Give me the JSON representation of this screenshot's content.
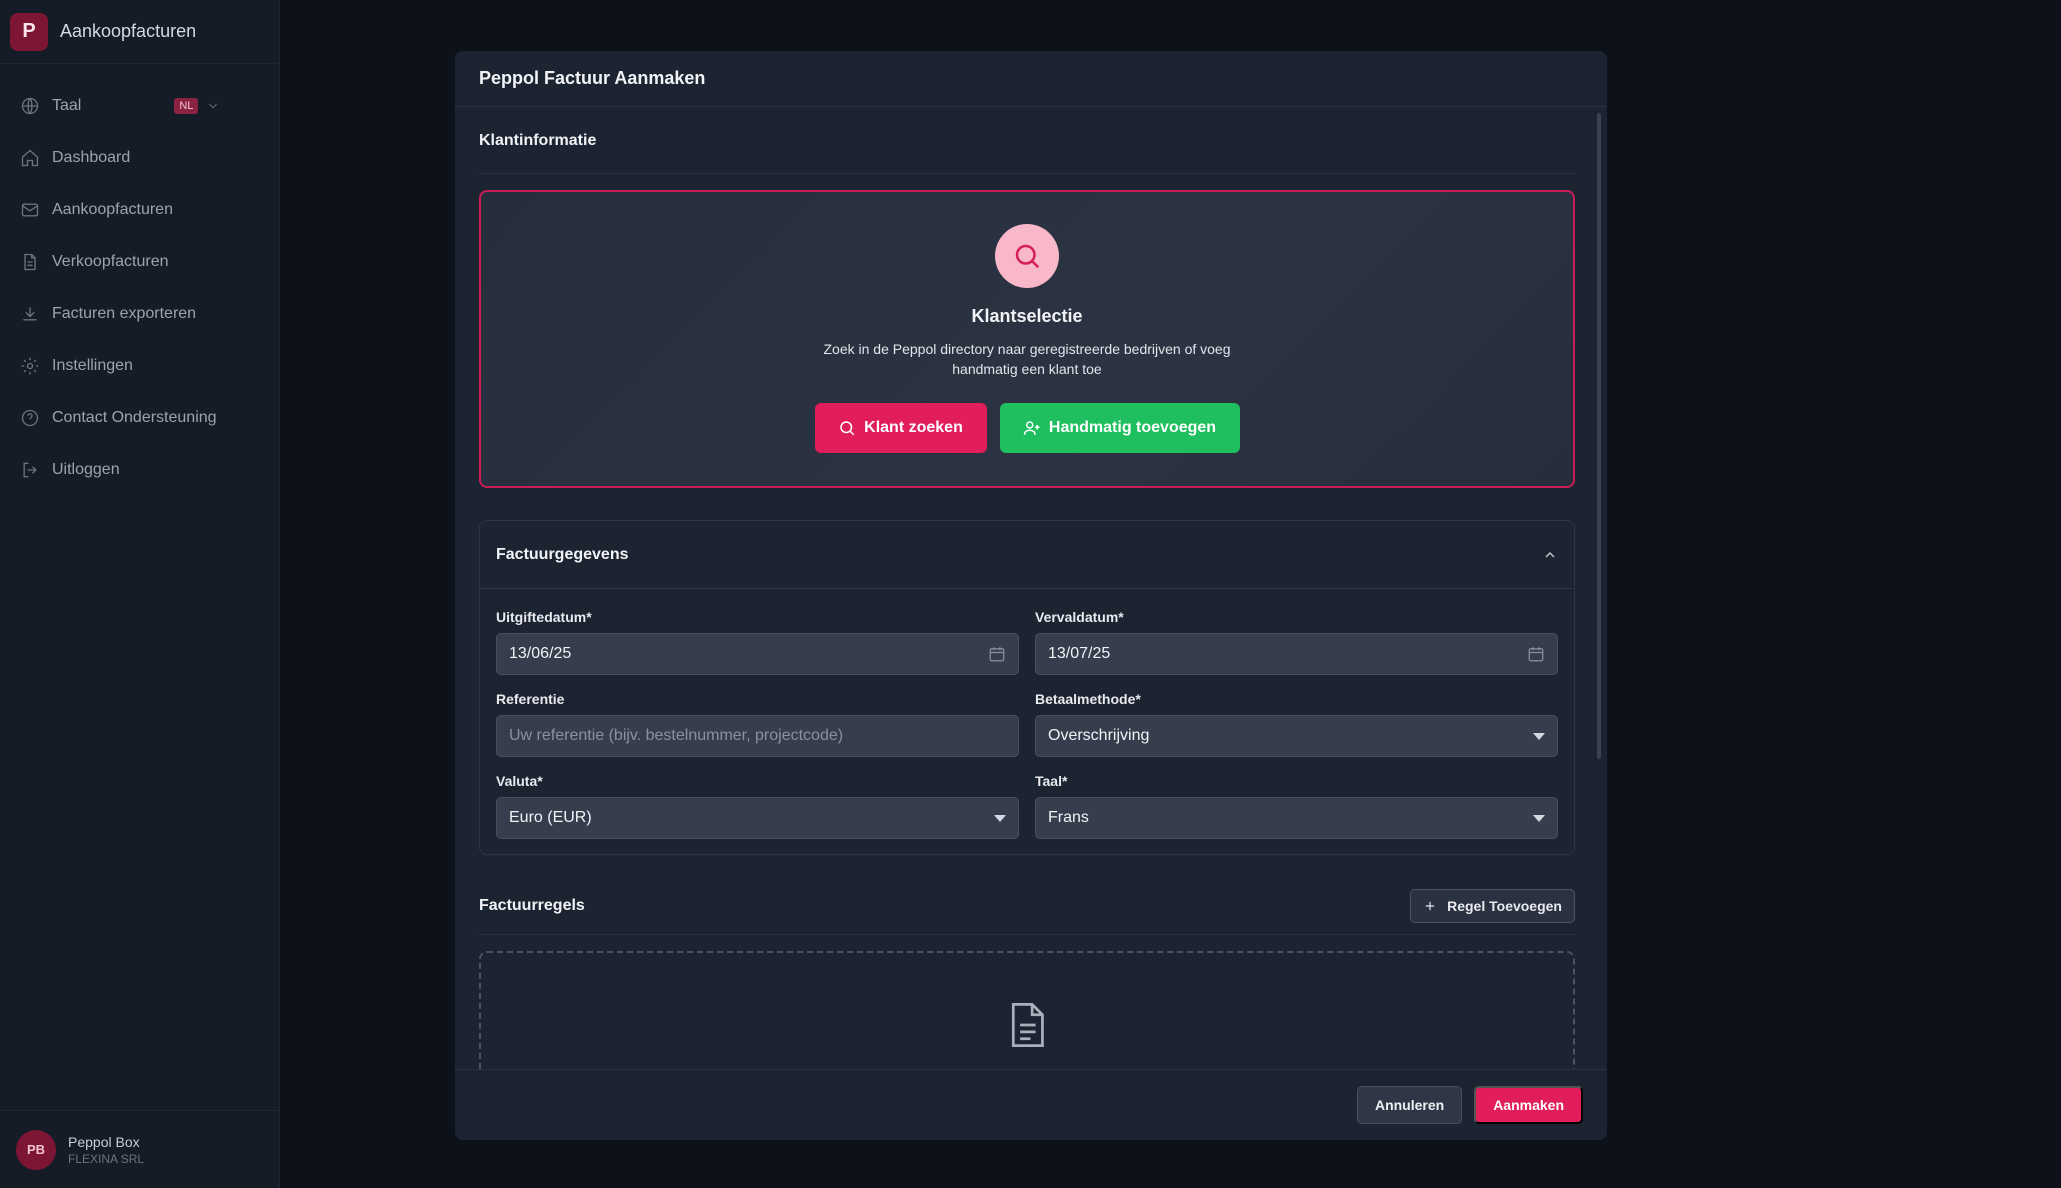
{
  "app": {
    "logo_letter": "P",
    "title": "Aankoopfacturen"
  },
  "sidebar": {
    "items": [
      {
        "label": "Taal",
        "icon": "globe-icon",
        "badge": "NL"
      },
      {
        "label": "Dashboard",
        "icon": "home-icon"
      },
      {
        "label": "Aankoopfacturen",
        "icon": "mail-icon"
      },
      {
        "label": "Verkoopfacturen",
        "icon": "document-icon"
      },
      {
        "label": "Facturen exporteren",
        "icon": "download-icon"
      },
      {
        "label": "Instellingen",
        "icon": "gear-icon"
      },
      {
        "label": "Contact Ondersteuning",
        "icon": "help-circle-icon"
      },
      {
        "label": "Uitloggen",
        "icon": "logout-icon"
      }
    ],
    "user": {
      "initials": "PB",
      "name": "Peppol Box",
      "company": "FLEXINA SRL"
    }
  },
  "modal": {
    "title": "Peppol Factuur Aanmaken",
    "klant": {
      "section_title": "Klantinformatie",
      "card_title": "Klantselectie",
      "description": "Zoek in de Peppol directory naar geregistreerde bedrijven of voeg handmatig een klant toe",
      "search_button": "Klant zoeken",
      "manual_button": "Handmatig toevoegen"
    },
    "factuur": {
      "section_title": "Factuurgegevens",
      "issue_date": {
        "label": "Uitgiftedatum*",
        "value": "13/06/25"
      },
      "due_date": {
        "label": "Vervaldatum*",
        "value": "13/07/25"
      },
      "reference": {
        "label": "Referentie",
        "placeholder": "Uw referentie (bijv. bestelnummer, projectcode)"
      },
      "payment_method": {
        "label": "Betaalmethode*",
        "value": "Overschrijving"
      },
      "currency": {
        "label": "Valuta*",
        "value": "Euro (EUR)"
      },
      "language": {
        "label": "Taal*",
        "value": "Frans"
      }
    },
    "regels": {
      "section_title": "Factuurregels",
      "add_button": "Regel Toevoegen"
    },
    "footer": {
      "cancel": "Annuleren",
      "create": "Aanmaken"
    }
  },
  "colors": {
    "accent": "#e11d5c",
    "success": "#1fbf5f",
    "background": "#0b0f18",
    "panel": "#1c2331"
  }
}
